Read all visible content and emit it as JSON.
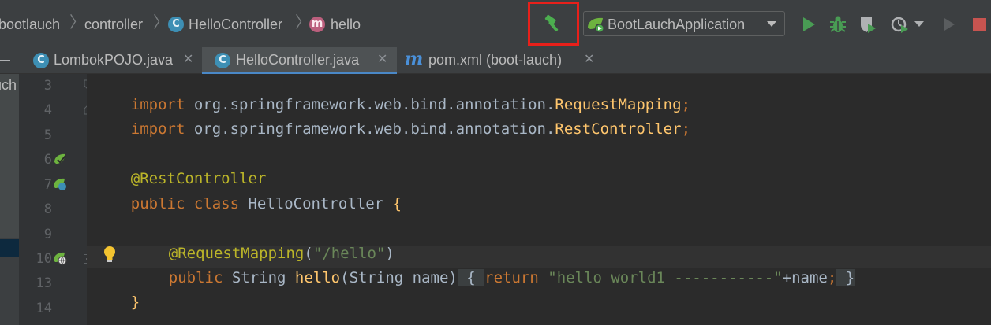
{
  "breadcrumb": {
    "items": [
      "bootlauch",
      "controller",
      "HelloController",
      "hello"
    ],
    "separator": "〉"
  },
  "toolbar": {
    "build_icon": "hammer-icon",
    "run_config_label": "BootLauchApplication",
    "icons": [
      "run-icon",
      "debug-icon",
      "coverage-icon",
      "profile-icon",
      "attach-icon",
      "stop-icon"
    ],
    "highlight_color": "#e8201a"
  },
  "tabs": [
    {
      "label": "LombokPOJO.java",
      "icon": "java-class-icon",
      "active": false
    },
    {
      "label": "HelloController.java",
      "icon": "java-class-icon",
      "active": true
    },
    {
      "label": "pom.xml (boot-lauch)",
      "icon": "maven-icon",
      "active": false
    }
  ],
  "left_strip": {
    "text": "uch"
  },
  "editor": {
    "lines": [
      {
        "num": "3",
        "text_keyword": "import ",
        "text_pkg": "org.springframework.web.bind.annotation.",
        "text_cls": "RequestMapping",
        "text_end": ";"
      },
      {
        "num": "4",
        "text_keyword": "import ",
        "text_pkg": "org.springframework.web.bind.annotation.",
        "text_cls": "RestController",
        "text_end": ";"
      },
      {
        "num": "5"
      },
      {
        "num": "6",
        "annotation": "@RestController"
      },
      {
        "num": "7",
        "kw1": "public ",
        "kw2": "class ",
        "name": "HelloController ",
        "brace": "{"
      },
      {
        "num": "8"
      },
      {
        "num": "9",
        "annotation": "@RequestMapping",
        "paren_open": "(",
        "string": "\"/hello\"",
        "paren_close": ")"
      },
      {
        "num": "10",
        "kw1": "public ",
        "type": "String ",
        "fn": "hello",
        "params": "(String name)",
        "body_open": " { ",
        "ret": "return ",
        "string": "\"hello world1 -----------\"",
        "concat": "+name",
        "semi": ";",
        "body_close": " }"
      },
      {
        "num": "13",
        "brace": "}"
      },
      {
        "num": "14"
      }
    ]
  },
  "colors": {
    "keyword": "#cc7832",
    "annotation": "#bbb529",
    "string": "#6a8759",
    "function": "#ffc66d",
    "default_text": "#a9b7c6",
    "background": "#2b2b2b"
  }
}
